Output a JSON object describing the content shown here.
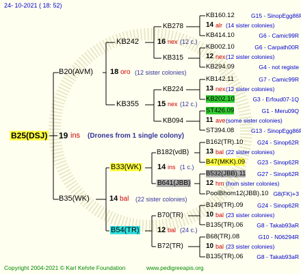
{
  "header": {
    "date": "24- 10-2021 ( 18: 52)"
  },
  "footer": {
    "copyright": "Copyright 2004-2021 © Karl Kehrle Foundation",
    "url": "www.pedigreeapis.org"
  },
  "root": {
    "name": "B25(DSJ)",
    "year": "19",
    "breed": "ins",
    "note": "(Drones from 1 single colony)"
  },
  "gen1": [
    {
      "name": "B20(AVM)",
      "year": "18",
      "breed": "oro",
      "sisters": "(12 sister colonies)"
    },
    {
      "name": "B35(WK)",
      "year": "14",
      "breed": "bal",
      "sisters": "(22 sister colonies)"
    }
  ],
  "gen2": [
    {
      "name": "KB242",
      "year": "16",
      "breed": "nex",
      "sisters": "(12 c.)"
    },
    {
      "name": "KB355",
      "year": "15",
      "breed": "nex",
      "sisters": "(12 c.)"
    },
    {
      "name": "B33(WK)",
      "year": "14",
      "breed": "ins",
      "sisters": "(1 c.)"
    },
    {
      "name": "B54(TR)",
      "year": "12",
      "breed": "bal",
      "sisters": "(24 c.)"
    }
  ],
  "gen3": [
    {
      "name": "KB278"
    },
    {
      "name": "KB315"
    },
    {
      "name": "KB224"
    },
    {
      "name": "KB094"
    },
    {
      "name": "B182(vdB)"
    },
    {
      "name": "B641(JBB)"
    },
    {
      "name": "B70(TR)"
    },
    {
      "name": "B72(TR)"
    }
  ],
  "gen4": [
    {
      "top": "KB160.12",
      "right": "G15 - SinopEgg86R",
      "year": "14",
      "breed": "alr",
      "sisters": "(14 sister colonies)",
      "bottom": "KB414.10",
      "right2": "G6 - Camic99R"
    },
    {
      "top": "KB002.10",
      "right": "G6 - Carpath00R",
      "year": "12",
      "breed": "nex",
      "sisters": "(12 sister colonies)",
      "bottom": "KB294.09",
      "right2": "G4 - not registe"
    },
    {
      "top": "KB142.11",
      "right": "G7 - Camic99R",
      "year": "13",
      "breed": "nex",
      "sisters": "(12 sister colonies)",
      "bottom": "KB202.10",
      "right2": "G3 - Erfoud07-1Q"
    },
    {
      "top": "ST426.09",
      "right": "G1 - Meru09Q",
      "year": "11",
      "breed": "ave",
      "sisters": "(some sister colonies)",
      "bottom": "ST394.08",
      "right2": "G13 - SinopEgg86R"
    },
    {
      "top": "B162(TR).10",
      "right": "G24 - Sinop62R",
      "year": "13",
      "breed": "bal",
      "sisters": "(22 sister colonies)",
      "bottom": "B47(MKK).09",
      "right2": "G23 - Sinop62R"
    },
    {
      "top": "B532(JBB).11",
      "right": "G27 - Sinop62R",
      "year": "12",
      "breed": "hm",
      "sisters": "(hom sister colonies)",
      "bottom": "PoolBhom12(JBB).10",
      "right2": "G8(FK)+3"
    },
    {
      "top": "B149(TR).09",
      "right": "G24 - Sinop62R",
      "year": "10",
      "breed": "bal",
      "sisters": "(23 sister colonies)",
      "bottom": "B135(TR).06",
      "right2": "G8 - Takab93aR"
    },
    {
      "top": "B68(TR).08",
      "right": "G10 - N06294R",
      "year": "10",
      "breed": "bal",
      "sisters": "(23 sister colonies)",
      "bottom": "B135(TR).06",
      "right2": "G8 - Takab93aR"
    }
  ]
}
